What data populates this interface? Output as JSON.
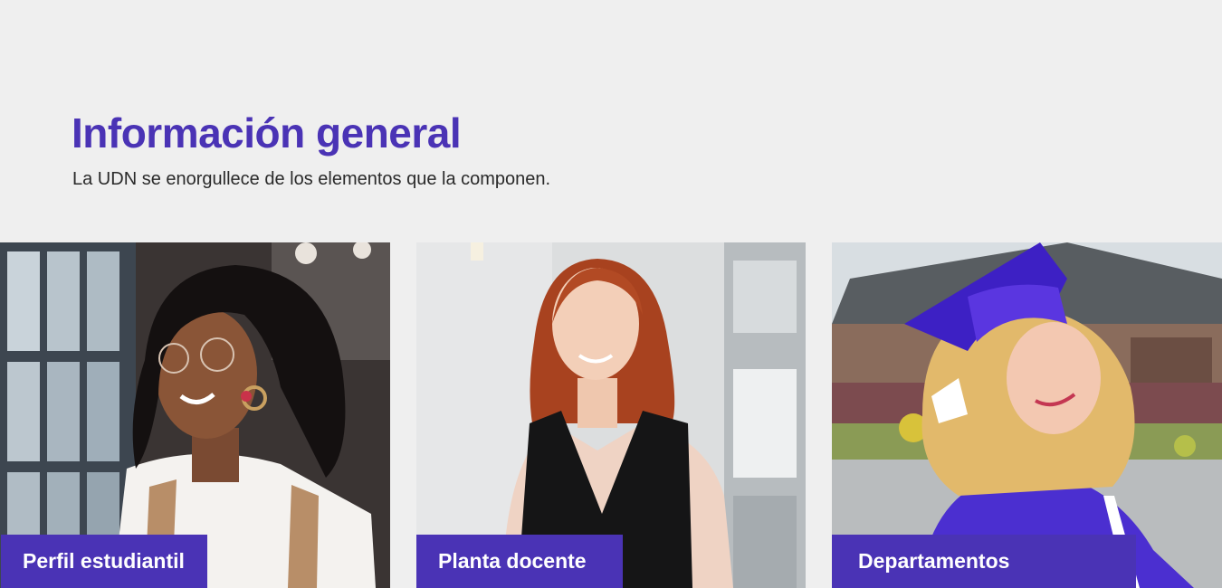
{
  "section": {
    "title": "Información general",
    "subtitle": "La UDN se enorgullece de los elementos que la componen."
  },
  "cards": [
    {
      "label": "Perfil estudiantil"
    },
    {
      "label": "Planta docente"
    },
    {
      "label": "Departamentos"
    }
  ],
  "colors": {
    "accent": "#4a33b5",
    "background": "#efefef",
    "label_text": "#ffffff"
  }
}
